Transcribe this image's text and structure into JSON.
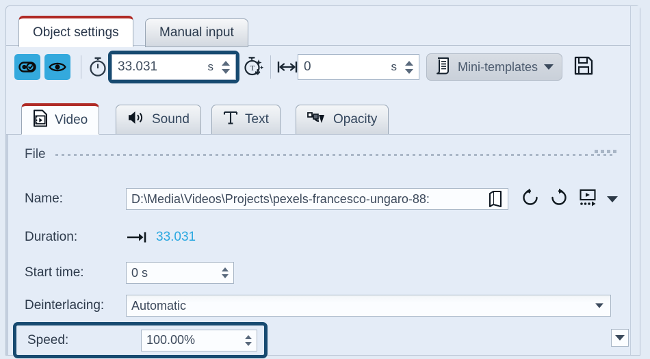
{
  "window": {
    "top_tabs": [
      {
        "label": "Object settings",
        "active": true
      },
      {
        "label": "Manual input",
        "active": false
      }
    ],
    "accent_red": "#b02b26",
    "highlight_navy": "#174a70",
    "toggle_blue": "#34a9dd",
    "link_blue": "#2ba8e0"
  },
  "toolbar": {
    "toggle_button_icon": "toggle-switch-check-icon",
    "visibility_button_icon": "eye-icon",
    "stopwatch_icon": "stopwatch-icon",
    "time_field": {
      "value": "33.031",
      "unit": "s",
      "highlighted": true
    },
    "effects_icon": "stopwatch-sparkle-icon",
    "span_icon": "horizontal-span-icon",
    "span_field": {
      "value": "0",
      "unit": "s"
    },
    "mini_templates": {
      "label": "Mini-templates",
      "icon": "document-list-icon",
      "caret": "chevron-down-icon"
    },
    "save_icon": "floppy-disk-icon"
  },
  "subtabs": [
    {
      "label": "Video",
      "icon": "video-file-icon",
      "active": true
    },
    {
      "label": "Sound",
      "icon": "speaker-icon",
      "active": false
    },
    {
      "label": "Text",
      "icon": "text-t-icon",
      "active": false
    },
    {
      "label": "Opacity",
      "icon": "opacity-curve-icon",
      "active": false
    }
  ],
  "panel": {
    "group_title": "File",
    "rows": {
      "name": {
        "label": "Name:",
        "value": "D:\\Media\\Videos\\Projects\\pexels-francesco-ungaro-88:",
        "browse_icon": "open-folder-icon",
        "rotate_ccw_icon": "rotate-counterclockwise-icon",
        "rotate_cw_icon": "rotate-clockwise-icon",
        "preview_icon": "preview-play-icon",
        "more_caret": "chevron-down-icon"
      },
      "duration": {
        "label": "Duration:",
        "arrow_icon": "arrow-to-end-icon",
        "value": "33.031"
      },
      "start_time": {
        "label": "Start time:",
        "value": "0 s"
      },
      "deinterlacing": {
        "label": "Deinterlacing:",
        "value": "Automatic",
        "caret": "chevron-down-icon"
      },
      "speed": {
        "label": "Speed:",
        "value": "100.00%",
        "highlighted": true
      }
    }
  },
  "scrollbar": {
    "down_arrow_icon": "chevron-down-icon"
  }
}
